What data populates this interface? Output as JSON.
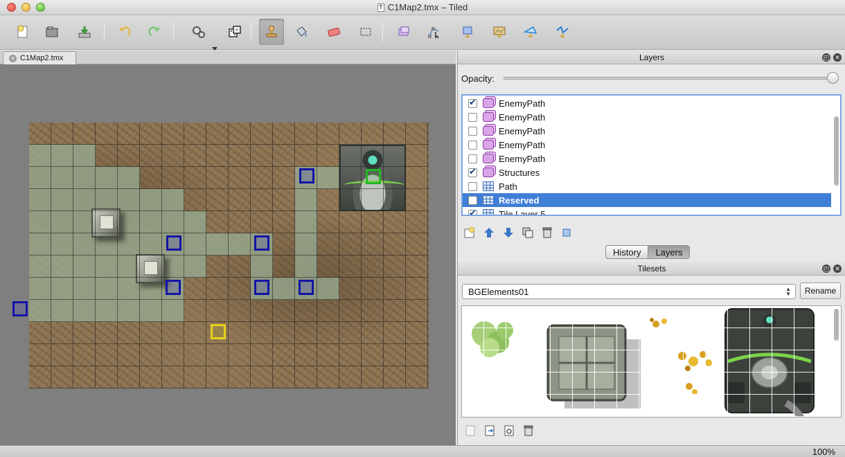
{
  "window": {
    "title": "C1Map2.tmx – Tiled"
  },
  "toolbar": {
    "buttons": [
      {
        "name": "new-map",
        "icon": "new-file-icon",
        "color": "#f4e27a"
      },
      {
        "name": "open",
        "icon": "folder-open-icon",
        "color": "#555555"
      },
      {
        "name": "save",
        "icon": "save-icon",
        "color": "#3a9a3a"
      },
      {
        "name": "undo",
        "icon": "undo-icon",
        "color": "#e0b84a"
      },
      {
        "name": "redo",
        "icon": "redo-icon",
        "color": "#78c878"
      },
      {
        "name": "command",
        "icon": "gears-icon",
        "color": "#666666"
      },
      {
        "name": "random",
        "icon": "dice-icon",
        "color": "#444444"
      },
      {
        "name": "stamp-brush",
        "icon": "stamp-icon",
        "color": "#c89a4a"
      },
      {
        "name": "bucket-fill",
        "icon": "bucket-icon",
        "color": "#7a8fa8"
      },
      {
        "name": "eraser",
        "icon": "eraser-icon",
        "color": "#e06060"
      },
      {
        "name": "rect-select",
        "icon": "rect-select-icon",
        "color": "#333333"
      },
      {
        "name": "select-objects",
        "icon": "select-objects-icon",
        "color": "#9a7fc8"
      },
      {
        "name": "edit-polygons",
        "icon": "edit-polygons-icon",
        "color": "#5a7fb8"
      },
      {
        "name": "insert-rectangle",
        "icon": "insert-rectangle-icon",
        "color": "#6a8fd8"
      },
      {
        "name": "insert-image",
        "icon": "insert-image-icon",
        "color": "#d8a040"
      },
      {
        "name": "insert-polygon",
        "icon": "insert-polygon-icon",
        "color": "#3a8fd8"
      },
      {
        "name": "insert-polyline",
        "icon": "insert-polyline-icon",
        "color": "#3a8fd8"
      }
    ]
  },
  "documents": {
    "tabs": [
      {
        "label": "C1Map2.tmx"
      }
    ]
  },
  "layers_panel": {
    "title": "Layers",
    "opacity_label": "Opacity:",
    "opacity_value": 1.0,
    "layers": [
      {
        "name": "EnemyPath",
        "type": "object",
        "visible": true,
        "selected": false
      },
      {
        "name": "EnemyPath",
        "type": "object",
        "visible": false,
        "selected": false
      },
      {
        "name": "EnemyPath",
        "type": "object",
        "visible": false,
        "selected": false
      },
      {
        "name": "EnemyPath",
        "type": "object",
        "visible": false,
        "selected": false
      },
      {
        "name": "EnemyPath",
        "type": "object",
        "visible": false,
        "selected": false
      },
      {
        "name": "Structures",
        "type": "object",
        "visible": true,
        "selected": false
      },
      {
        "name": "Path",
        "type": "tile",
        "visible": false,
        "selected": false
      },
      {
        "name": "Reserved",
        "type": "tile",
        "visible": false,
        "selected": true
      },
      {
        "name": "Tile Layer 5",
        "type": "tile",
        "visible": true,
        "selected": false
      }
    ],
    "tool_icons": [
      "add-layer-icon",
      "move-layer-up-icon",
      "move-layer-down-icon",
      "duplicate-layer-icon",
      "delete-layer-icon",
      "layer-properties-icon"
    ]
  },
  "panel_tabs": [
    {
      "label": "History",
      "active": false
    },
    {
      "label": "Layers",
      "active": true
    }
  ],
  "tilesets_panel": {
    "title": "Tilesets",
    "selected_tileset": "BGElements01",
    "rename_label": "Rename",
    "tool_icons": [
      "import-tileset-icon",
      "export-tileset-icon",
      "tileset-properties-icon",
      "delete-tileset-icon"
    ]
  },
  "status": {
    "zoom": "100%"
  },
  "colors": {
    "selection": "#3f7fd6",
    "canvas_bg": "#7f7f7f",
    "path_tint": "#96aa91",
    "marker_blue": "#1414a6",
    "marker_green": "#25b625",
    "marker_yellow": "#e6d21a"
  }
}
